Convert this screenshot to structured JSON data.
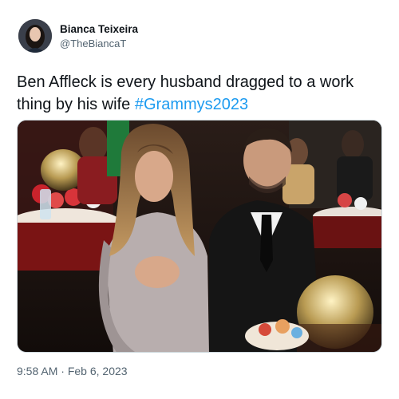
{
  "author": {
    "display_name": "Bianca Teixeira",
    "handle": "@TheBiancaT"
  },
  "tweet": {
    "text": "Ben Affleck is every husband dragged to a work thing by his wife ",
    "hashtag": "#Grammys2023"
  },
  "meta": {
    "time": "9:58 AM",
    "separator": " · ",
    "date": "Feb 6, 2023"
  },
  "colors": {
    "link": "#1d9bf0",
    "secondary_text": "#536471",
    "primary_text": "#0f1419"
  }
}
